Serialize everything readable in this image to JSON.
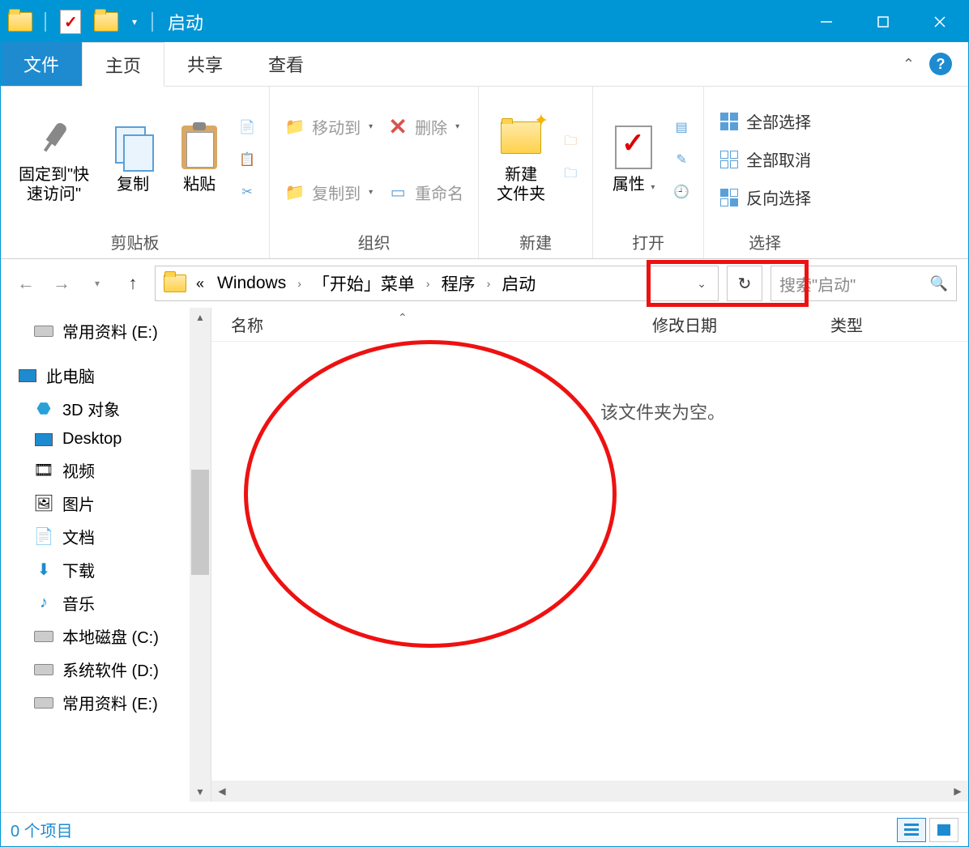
{
  "title": "启动",
  "tabs": {
    "file": "文件",
    "home": "主页",
    "share": "共享",
    "view": "查看"
  },
  "ribbon": {
    "clipboard": {
      "label": "剪贴板",
      "pin": "固定到\"快\n速访问\"",
      "copy": "复制",
      "paste": "粘贴"
    },
    "organize": {
      "label": "组织",
      "moveTo": "移动到",
      "copyTo": "复制到",
      "delete": "删除",
      "rename": "重命名"
    },
    "new_": {
      "label": "新建",
      "newFolder": "新建\n文件夹"
    },
    "open": {
      "label": "打开",
      "properties": "属性"
    },
    "select": {
      "label": "选择",
      "selectAll": "全部选择",
      "selectNone": "全部取消",
      "invert": "反向选择"
    }
  },
  "breadcrumb": {
    "items": [
      "Windows",
      "「开始」菜单",
      "程序",
      "启动"
    ]
  },
  "search": {
    "placeholder": "搜索\"启动\""
  },
  "columns": {
    "name": "名称",
    "modified": "修改日期",
    "type": "类型"
  },
  "emptyMsg": "该文件夹为空。",
  "tree": {
    "root": "此电脑",
    "items": [
      "常用资料 (E:)",
      "3D 对象",
      "Desktop",
      "视频",
      "图片",
      "文档",
      "下载",
      "音乐",
      "本地磁盘 (C:)",
      "系统软件 (D:)",
      "常用资料 (E:)"
    ]
  },
  "status": "0 个项目"
}
